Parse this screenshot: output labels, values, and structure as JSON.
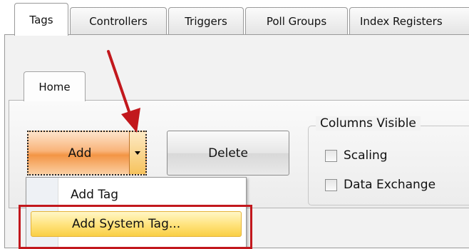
{
  "top_tabs": [
    "Tags",
    "Controllers",
    "Triggers",
    "Poll Groups",
    "Index Registers"
  ],
  "ribbon": {
    "tab_home": "Home",
    "add_label": "Add",
    "delete_label": "Delete",
    "columns_group_title": "Columns Visible",
    "checkboxes": [
      {
        "label": "Scaling",
        "checked": false
      },
      {
        "label": "Data Exchange",
        "checked": false
      }
    ]
  },
  "dropdown_menu": {
    "items": [
      "Add Tag",
      "Add System Tag..."
    ],
    "highlighted_index": 1
  },
  "colors": {
    "annotation_red": "#c2181d",
    "add_button_orange": "#f39545",
    "menu_highlight": "#ffe27a"
  }
}
